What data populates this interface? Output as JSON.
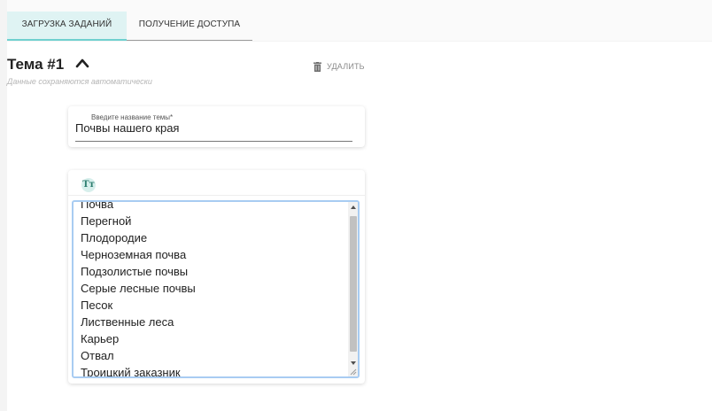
{
  "tabs": [
    {
      "label": "ЗАГРУЗКА ЗАДАНИЙ",
      "active": true
    },
    {
      "label": "ПОЛУЧЕНИЕ ДОСТУПА",
      "active": false
    }
  ],
  "topic": {
    "title": "Тема #1",
    "autosave_note": "Данные сохраняются автоматически",
    "delete_label": "УДАЛИТЬ",
    "name_field": {
      "label": "Введите название темы*",
      "value": "Почвы нашего края"
    }
  },
  "editor": {
    "format_icon": "text-format-icon",
    "format_glyph": "Tт",
    "items": [
      "Почва",
      "Перегной",
      "Плодородие",
      "Черноземная почва",
      "Подзолистые почвы",
      "Серые лесные почвы",
      "Песок",
      "Лиственные леса",
      "Карьер",
      "Отвал",
      "Троицкий заказник"
    ]
  },
  "colors": {
    "accent": "#6fd0cf",
    "active_tab_bg": "#dff3f3",
    "focus_border": "#a8ccf2"
  }
}
